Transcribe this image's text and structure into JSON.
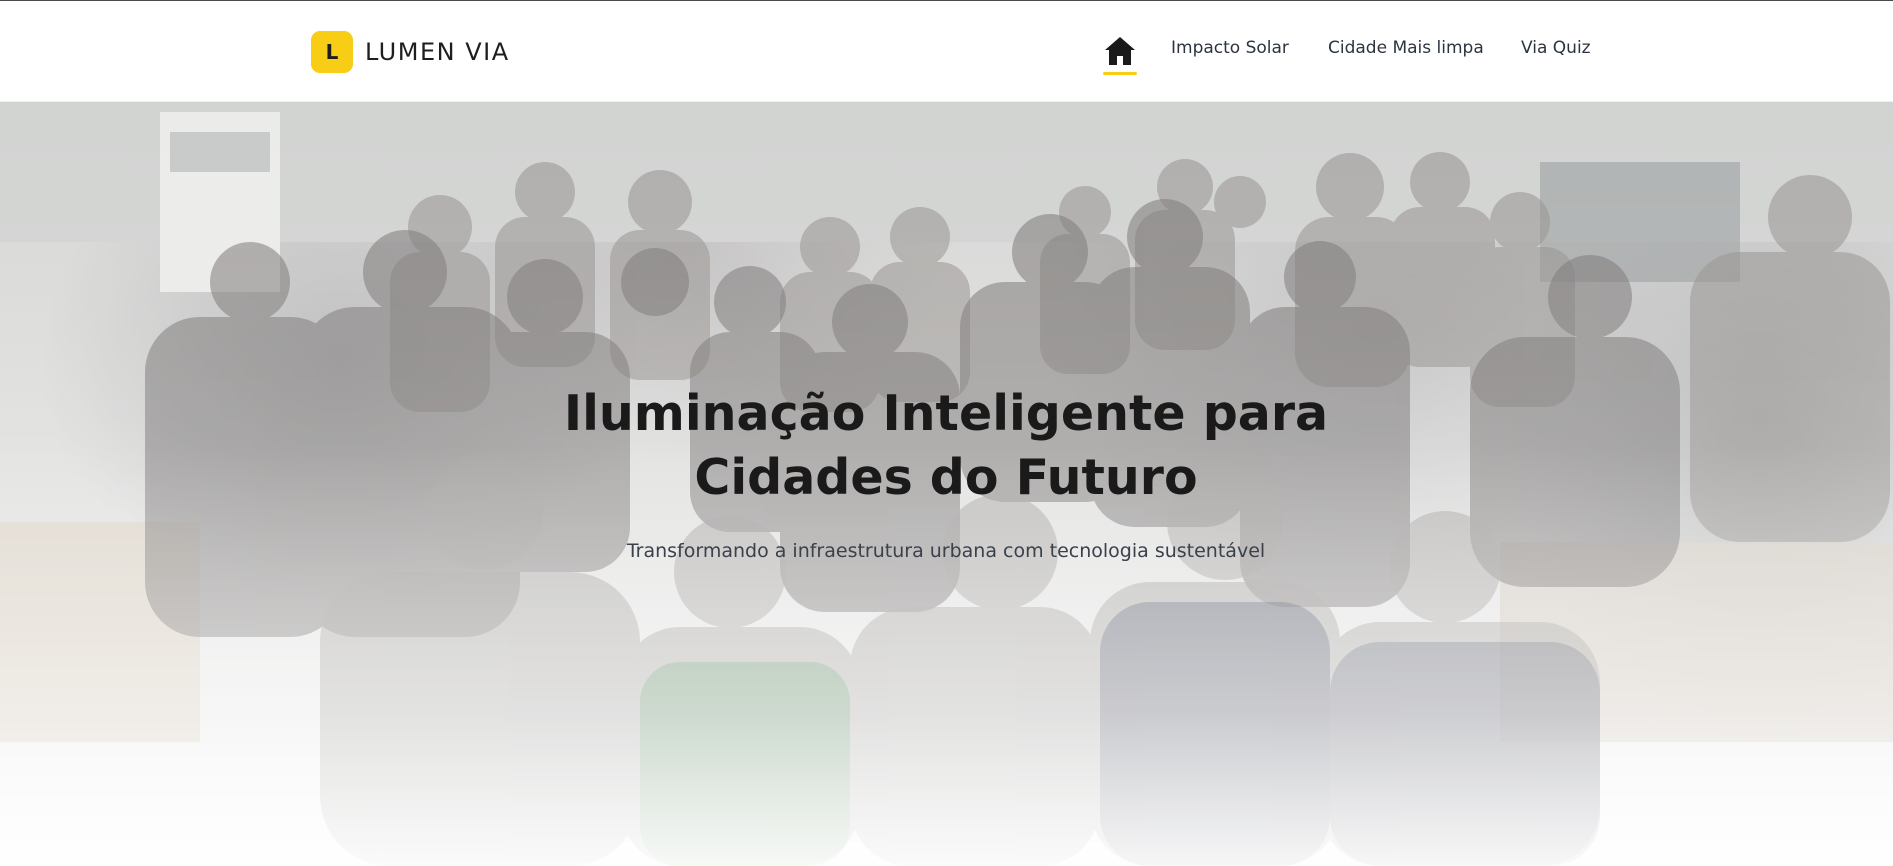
{
  "header": {
    "logo_letter": "L",
    "brand_name": "LUMEN VIA",
    "logo_color": "#f7cd16",
    "nav": {
      "home_icon": "home-icon",
      "items": [
        {
          "label": "Impacto Solar"
        },
        {
          "label": "Cidade Mais limpa"
        },
        {
          "label": "Via Quiz"
        }
      ]
    }
  },
  "hero": {
    "title_line1": "Iluminação Inteligente para",
    "title_line2": "Cidades do Futuro",
    "subtitle": "Transformando a infraestrutura urbana com tecnologia sustentável"
  }
}
